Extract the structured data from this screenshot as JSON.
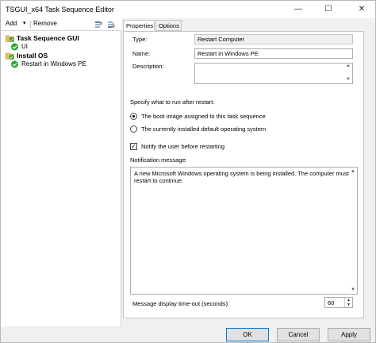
{
  "window": {
    "title": "TSGUI_x64 Task Sequence Editor",
    "controls": {
      "minimize": "—",
      "maximize": "☐",
      "close": "✕"
    }
  },
  "toolbar": {
    "add_label": "Add",
    "add_caret": "▾",
    "remove_label": "Remove",
    "icons": [
      "move-up-icon",
      "move-down-icon"
    ]
  },
  "tree": {
    "items": [
      {
        "label": "Task Sequence GUI",
        "level": 0,
        "icon": "folder-check-icon"
      },
      {
        "label": "UI",
        "level": 1,
        "icon": "check-icon"
      },
      {
        "label": "Install OS",
        "level": 0,
        "icon": "folder-check-icon"
      },
      {
        "label": "Restart in Windows PE",
        "level": 1,
        "icon": "check-icon"
      }
    ]
  },
  "tabs": [
    {
      "label": "Properties",
      "active": true
    },
    {
      "label": "Options",
      "active": false
    }
  ],
  "properties": {
    "type_label": "Type:",
    "type_value": "Restart Computer",
    "name_label": "Name:",
    "name_value": "Restart in Windows PE",
    "description_label": "Description:",
    "description_value": "",
    "specify_label": "Specify what to run after restart:",
    "radio_options": [
      {
        "label": "The boot image assigned to this task sequence",
        "checked": true
      },
      {
        "label": "The currently installed default operating system",
        "checked": false
      }
    ],
    "notify_label": "Notify the user before restarting",
    "notify_checked": true,
    "notification_label": "Notification message:",
    "notification_text": "A new Microsoft Windows operating system is being installed. The computer must restart to continue.",
    "timeout_label": "Message display time-out (seconds):",
    "timeout_value": "60"
  },
  "buttons": {
    "ok": "OK",
    "cancel": "Cancel",
    "apply": "Apply"
  },
  "colors": {
    "check_green": "#2da337",
    "folder_yellow": "#e8c05a",
    "accent": "#0078d7"
  }
}
